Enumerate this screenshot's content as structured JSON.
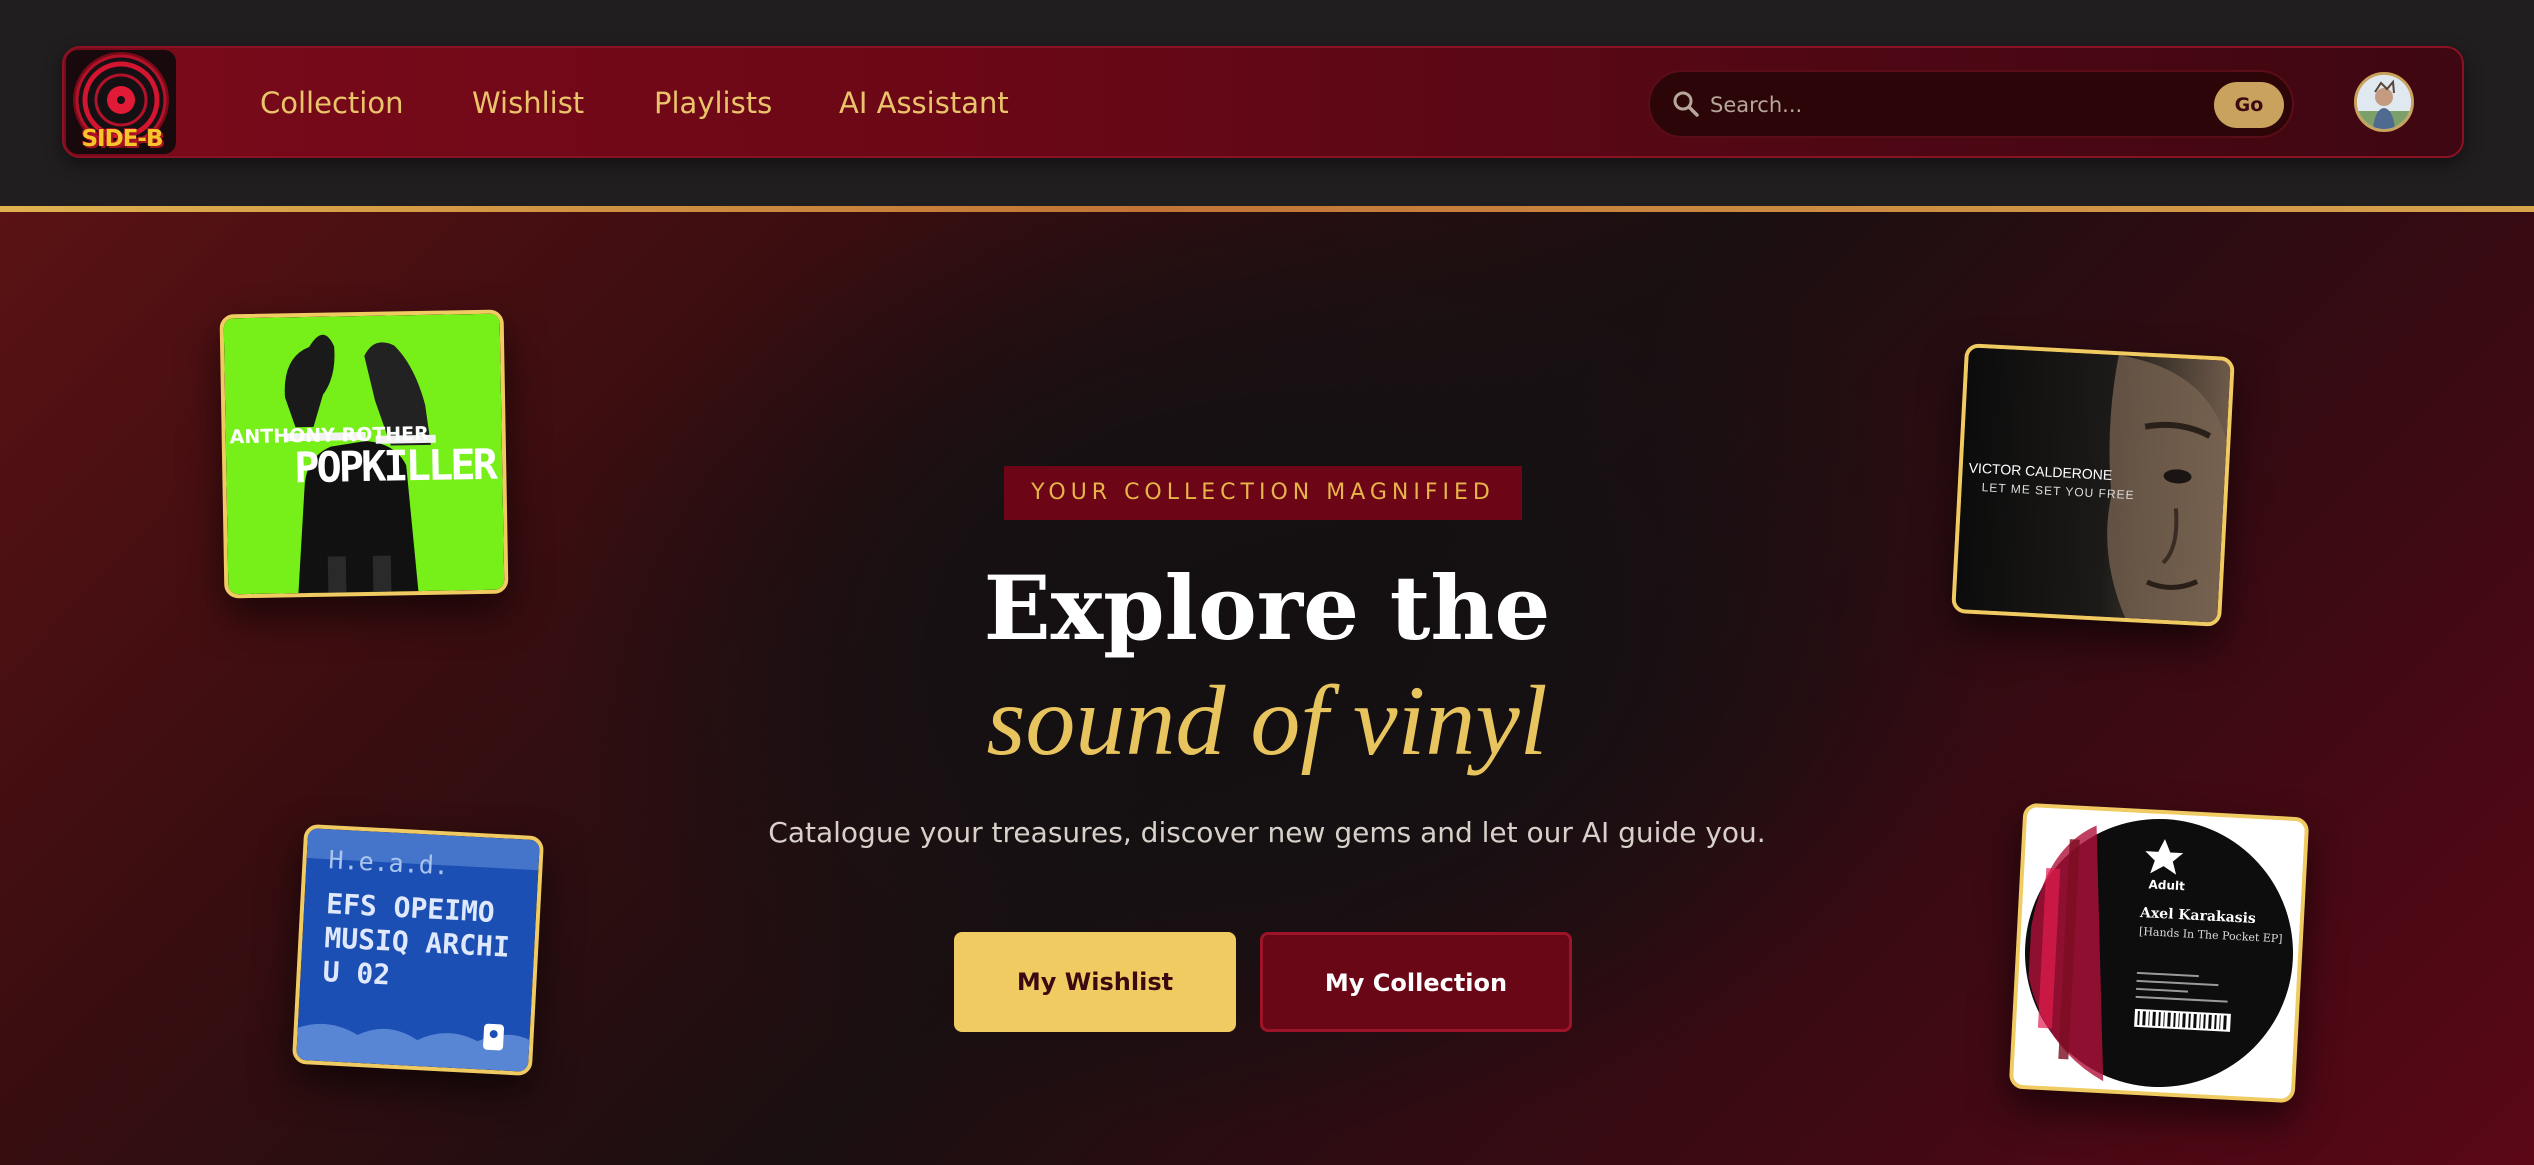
{
  "header": {
    "logo_text": "SIDE-B",
    "nav": [
      {
        "label": "Collection"
      },
      {
        "label": "Wishlist"
      },
      {
        "label": "Playlists"
      },
      {
        "label": "AI Assistant"
      }
    ],
    "search": {
      "placeholder": "Search...",
      "value": "",
      "button_label": "Go"
    },
    "avatar_icon": "user-avatar"
  },
  "hero": {
    "tagline": "YOUR COLLECTION MAGNIFIED",
    "title_line1": "Explore the",
    "title_line2": "sound of vinyl",
    "subtitle": "Catalogue your treasures, discover new gems and let our AI guide you.",
    "buttons": {
      "wishlist": "My Wishlist",
      "collection": "My Collection"
    }
  },
  "album_covers": [
    {
      "artist": "ANTHONY ROTHER",
      "title": "POPKILLER"
    },
    {
      "artist": "VICTOR CALDERONE",
      "title": "LET ME SET YOU FREE"
    },
    {
      "artist": "H.e.a.d.",
      "title": "EFS OPEIMO MUSIQ ARCHIU 02"
    },
    {
      "artist": "Axel Karakasis",
      "title": "[Hands In The Pocket EP]",
      "label": "Adult"
    }
  ],
  "colors": {
    "accent_gold": "#f0cb62",
    "brand_crimson": "#6c0616",
    "background_dark": "#1f1d1e"
  }
}
